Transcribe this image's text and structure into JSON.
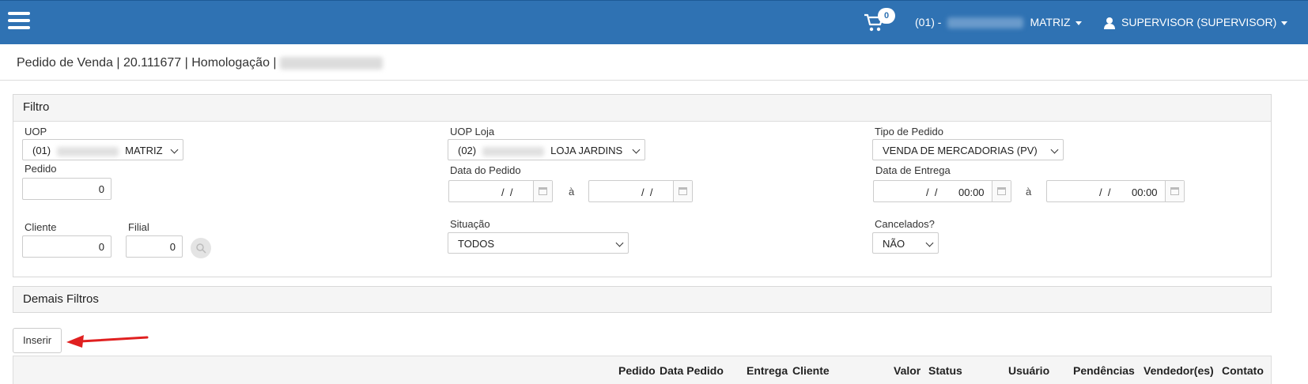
{
  "topbar": {
    "cart_count": "0",
    "uop_prefix": "(01) -",
    "uop_name": "MATRIZ",
    "user": "SUPERVISOR (SUPERVISOR)"
  },
  "breadcrumb": {
    "text": "Pedido de Venda | 20.111677 | Homologação |"
  },
  "filtro": {
    "title": "Filtro",
    "uop_label": "UOP",
    "uop_code": "(01)",
    "uop_name": "MATRIZ",
    "pedido_label": "Pedido",
    "pedido_value": "0",
    "cliente_label": "Cliente",
    "cliente_value": "0",
    "filial_label": "Filial",
    "filial_value": "0",
    "uop_loja_label": "UOP Loja",
    "uop_loja_code": "(02)",
    "uop_loja_name": "LOJA JARDINS",
    "data_pedido_label": "Data do Pedido",
    "data_pedido_from": "/  /",
    "data_pedido_to": "/  /",
    "range_sep": "à",
    "situacao_label": "Situação",
    "situacao_value": "TODOS",
    "tipo_label": "Tipo de Pedido",
    "tipo_value": "VENDA DE MERCADORIAS (PV)",
    "entrega_label": "Data de Entrega",
    "entrega_from_date": "/  /",
    "entrega_from_time": "00:00",
    "entrega_to_date": "/  /",
    "entrega_to_time": "00:00",
    "cancelados_label": "Cancelados?",
    "cancelados_value": "NÃO"
  },
  "demais": {
    "title": "Demais Filtros"
  },
  "actions": {
    "inserir": "Inserir"
  },
  "table": {
    "columns": [
      "Pedido",
      "Data Pedido",
      "Entrega",
      "Cliente",
      "Valor",
      "Status",
      "Usuário",
      "Pendências",
      "Vendedor(es)",
      "Contato"
    ]
  },
  "colors": {
    "topbar": "#2f72b3",
    "annotation_arrow": "#e02020"
  },
  "icons": [
    "menu-icon",
    "cart-icon",
    "caret-down-icon",
    "user-icon",
    "calendar-icon",
    "search-icon",
    "chevron-down-icon",
    "arrow-annotation"
  ]
}
